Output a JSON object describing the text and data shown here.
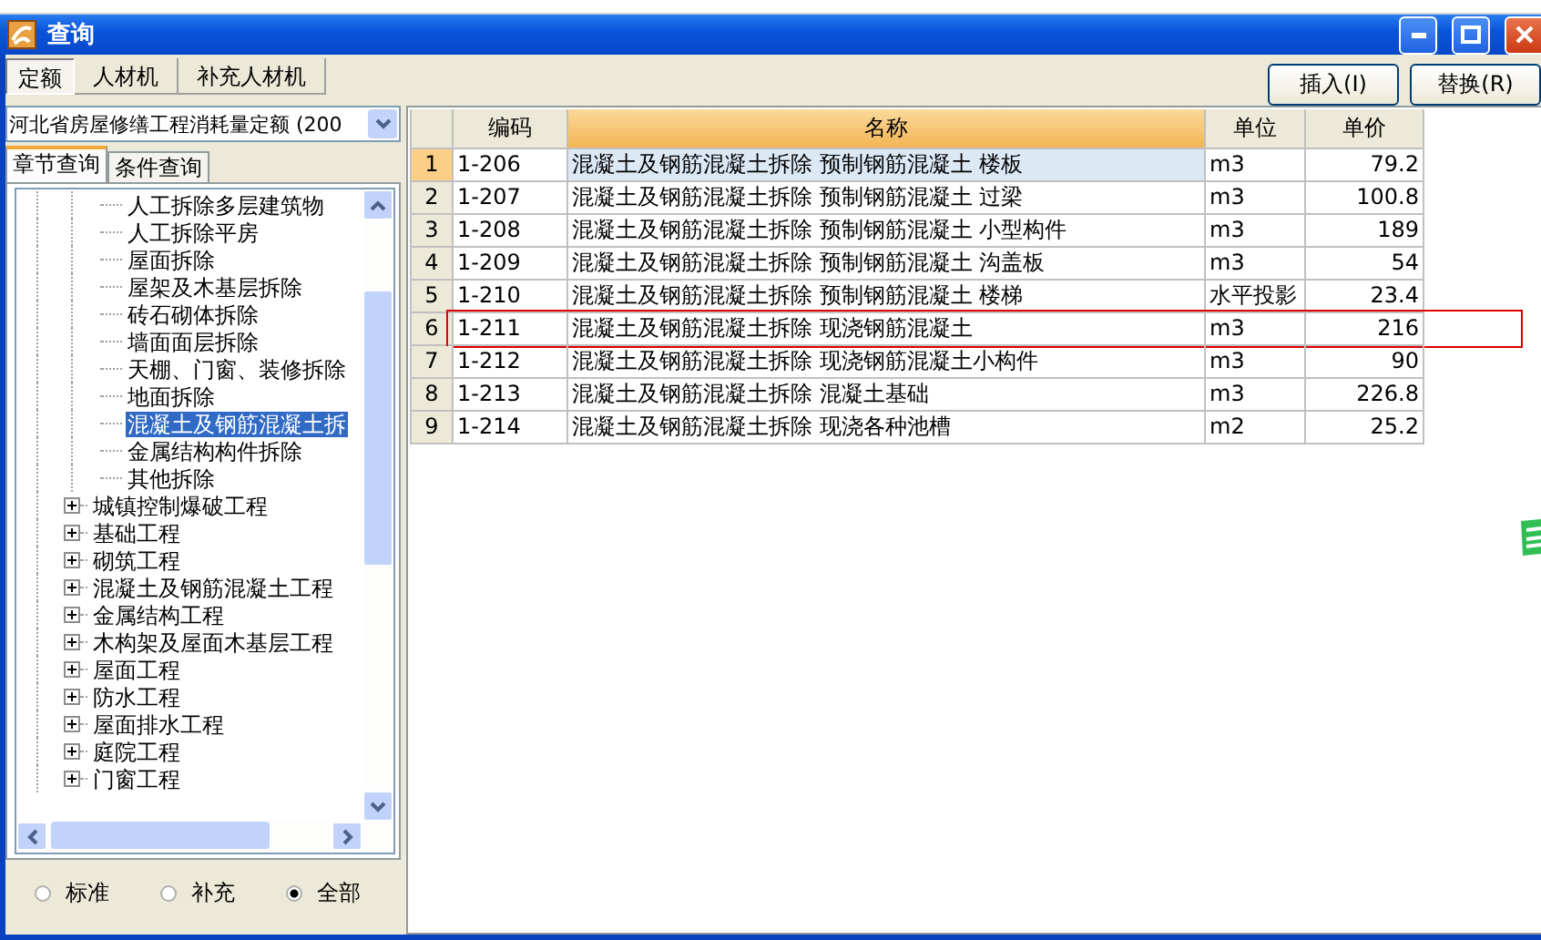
{
  "window": {
    "title": "查询"
  },
  "tabs": [
    {
      "label": "定额",
      "selected": true
    },
    {
      "label": "人材机",
      "selected": false
    },
    {
      "label": "补充人材机",
      "selected": false
    }
  ],
  "actions": [
    {
      "label": "插入(I)"
    },
    {
      "label": "替换(R)"
    }
  ],
  "left_panel": {
    "combo": {
      "value": "河北省房屋修缮工程消耗量定额 (200"
    },
    "tabs": [
      {
        "label": "章节查询",
        "selected": true
      },
      {
        "label": "条件查询",
        "selected": false
      }
    ],
    "tree": {
      "items": [
        {
          "expanded": true,
          "children": [
            {
              "label": "人工拆除多层建筑物",
              "selected": false
            },
            {
              "label": "人工拆除平房",
              "selected": false
            },
            {
              "label": "屋面拆除",
              "selected": false
            },
            {
              "label": "屋架及木基层拆除",
              "selected": false
            },
            {
              "label": "砖石砌体拆除",
              "selected": false
            },
            {
              "label": "墙面面层拆除",
              "selected": false
            },
            {
              "label": "天棚、门窗、装修拆除",
              "selected": false
            },
            {
              "label": "地面拆除",
              "selected": false
            },
            {
              "label": "混凝土及钢筋混凝土拆",
              "selected": true
            },
            {
              "label": "金属结构构件拆除",
              "selected": false
            },
            {
              "label": "其他拆除",
              "selected": false
            }
          ]
        },
        {
          "label": "城镇控制爆破工程",
          "expanded": false
        },
        {
          "label": "基础工程",
          "expanded": false
        },
        {
          "label": "砌筑工程",
          "expanded": false
        },
        {
          "label": "混凝土及钢筋混凝土工程",
          "expanded": false
        },
        {
          "label": "金属结构工程",
          "expanded": false
        },
        {
          "label": "木构架及屋面木基层工程",
          "expanded": false
        },
        {
          "label": "屋面工程",
          "expanded": false
        },
        {
          "label": "防水工程",
          "expanded": false
        },
        {
          "label": "屋面排水工程",
          "expanded": false
        },
        {
          "label": "庭院工程",
          "expanded": false
        },
        {
          "label": "门窗工程",
          "expanded": false
        }
      ]
    },
    "filter": [
      {
        "label": "标准",
        "selected": false
      },
      {
        "label": "补充",
        "selected": false
      },
      {
        "label": "全部",
        "selected": true
      }
    ]
  },
  "table": {
    "columns": [
      {
        "label": "编码",
        "sorted": false
      },
      {
        "label": "名称",
        "sorted": true
      },
      {
        "label": "单位",
        "sorted": false
      },
      {
        "label": "单价",
        "sorted": false
      }
    ],
    "rows": [
      {
        "index": "1",
        "code": "1-206",
        "name": "混凝土及钢筋混凝土拆除 预制钢筋混凝土 楼板",
        "unit": "m3",
        "price": "79.2",
        "current": true,
        "marked": false
      },
      {
        "index": "2",
        "code": "1-207",
        "name": "混凝土及钢筋混凝土拆除 预制钢筋混凝土 过梁",
        "unit": "m3",
        "price": "100.8",
        "current": false,
        "marked": false
      },
      {
        "index": "3",
        "code": "1-208",
        "name": "混凝土及钢筋混凝土拆除 预制钢筋混凝土 小型构件",
        "unit": "m3",
        "price": "189",
        "current": false,
        "marked": false
      },
      {
        "index": "4",
        "code": "1-209",
        "name": "混凝土及钢筋混凝土拆除 预制钢筋混凝土 沟盖板",
        "unit": "m3",
        "price": "54",
        "current": false,
        "marked": false
      },
      {
        "index": "5",
        "code": "1-210",
        "name": "混凝土及钢筋混凝土拆除 预制钢筋混凝土 楼梯",
        "unit": "水平投影",
        "price": "23.4",
        "current": false,
        "marked": false
      },
      {
        "index": "6",
        "code": "1-211",
        "name": "混凝土及钢筋混凝土拆除 现浇钢筋混凝土",
        "unit": "m3",
        "price": "216",
        "current": false,
        "marked": true
      },
      {
        "index": "7",
        "code": "1-212",
        "name": "混凝土及钢筋混凝土拆除 现浇钢筋混凝土小构件",
        "unit": "m3",
        "price": "90",
        "current": false,
        "marked": false
      },
      {
        "index": "8",
        "code": "1-213",
        "name": "混凝土及钢筋混凝土拆除 混凝土基础",
        "unit": "m3",
        "price": "226.8",
        "current": false,
        "marked": false
      },
      {
        "index": "9",
        "code": "1-214",
        "name": "混凝土及钢筋混凝土拆除 现浇各种池槽",
        "unit": "m2",
        "price": "25.2",
        "current": false,
        "marked": false
      }
    ]
  }
}
